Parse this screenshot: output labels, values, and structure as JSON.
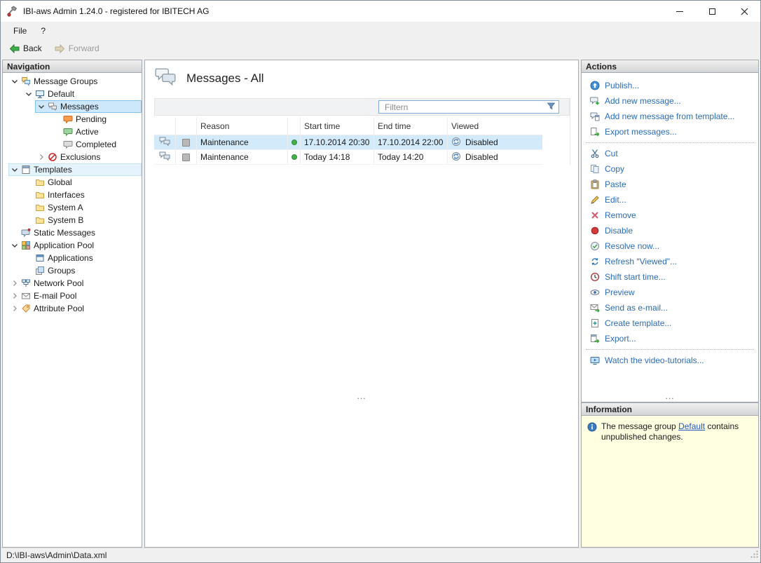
{
  "window": {
    "title": "IBI-aws Admin 1.24.0 - registered for IBITECH AG"
  },
  "menu": {
    "file": "File",
    "help": "?"
  },
  "toolbar": {
    "back": "Back",
    "forward": "Forward"
  },
  "navigation": {
    "header": "Navigation",
    "tree": [
      {
        "label": "Message Groups"
      },
      {
        "label": "Default"
      },
      {
        "label": "Messages"
      },
      {
        "label": "Pending"
      },
      {
        "label": "Active"
      },
      {
        "label": "Completed"
      },
      {
        "label": "Exclusions"
      },
      {
        "label": "Templates"
      },
      {
        "label": "Global"
      },
      {
        "label": "Interfaces"
      },
      {
        "label": "System A"
      },
      {
        "label": "System B"
      },
      {
        "label": "Static Messages"
      },
      {
        "label": "Application Pool"
      },
      {
        "label": "Applications"
      },
      {
        "label": "Groups"
      },
      {
        "label": "Network Pool"
      },
      {
        "label": "E-mail Pool"
      },
      {
        "label": "Attribute Pool"
      }
    ]
  },
  "main": {
    "title": "Messages - All",
    "filter": {
      "placeholder": "Filtern"
    },
    "table": {
      "columns": {
        "reason": "Reason",
        "start": "Start time",
        "end": "End time",
        "viewed": "Viewed"
      },
      "rows": [
        {
          "reason": "Maintenance",
          "start": "17.10.2014 20:30",
          "end": "17.10.2014 22:00",
          "viewed": "Disabled"
        },
        {
          "reason": "Maintenance",
          "start": "Today 14:18",
          "end": "Today 14:20",
          "viewed": "Disabled"
        }
      ]
    },
    "overflow": "..."
  },
  "actions": {
    "header": "Actions",
    "items": [
      {
        "label": "Publish..."
      },
      {
        "label": "Add new message..."
      },
      {
        "label": "Add new message from template..."
      },
      {
        "label": "Export messages..."
      },
      {
        "label": "Cut"
      },
      {
        "label": "Copy"
      },
      {
        "label": "Paste"
      },
      {
        "label": "Edit..."
      },
      {
        "label": "Remove"
      },
      {
        "label": "Disable"
      },
      {
        "label": "Resolve now..."
      },
      {
        "label": "Refresh \"Viewed\"..."
      },
      {
        "label": "Shift start time..."
      },
      {
        "label": "Preview"
      },
      {
        "label": "Send as e-mail..."
      },
      {
        "label": "Create template..."
      },
      {
        "label": "Export..."
      },
      {
        "label": "Watch the video-tutorials..."
      }
    ],
    "overflow": "..."
  },
  "information": {
    "header": "Information",
    "text_before": "The message group",
    "link": "Default",
    "text_after": "contains unpublished changes."
  },
  "statusbar": {
    "path": "D:\\IBI-aws\\Admin\\Data.xml"
  },
  "colors": {
    "action_link": "#2b6cb8",
    "selection_blue": "#cde8fa",
    "row_selection": "#d2eafa",
    "info_background": "#ffffe1",
    "status_green": "#43b049"
  }
}
